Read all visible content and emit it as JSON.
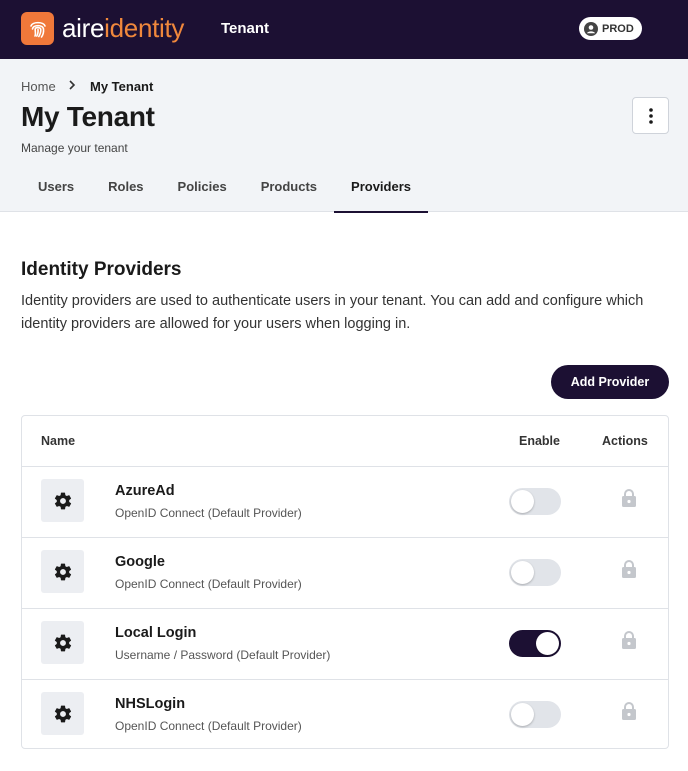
{
  "app": {
    "brand_part1": "aire",
    "brand_part2": "identity",
    "section_title": "Tenant",
    "environment": "PROD"
  },
  "breadcrumb": {
    "home": "Home",
    "current": "My Tenant"
  },
  "page": {
    "title": "My Tenant",
    "subtitle": "Manage your tenant"
  },
  "tabs": [
    {
      "label": "Users",
      "active": false
    },
    {
      "label": "Roles",
      "active": false
    },
    {
      "label": "Policies",
      "active": false
    },
    {
      "label": "Products",
      "active": false
    },
    {
      "label": "Providers",
      "active": true
    }
  ],
  "providers_section": {
    "title": "Identity Providers",
    "description": "Identity providers are used to authenticate users in your tenant. You can add and configure which identity providers are allowed for your users when logging in.",
    "add_button": "Add Provider"
  },
  "table": {
    "headers": {
      "name": "Name",
      "enable": "Enable",
      "actions": "Actions"
    },
    "rows": [
      {
        "name": "AzureAd",
        "type": "OpenID Connect (Default Provider)",
        "enabled": false,
        "icon": "gear-icon",
        "action_icon": "lock-icon"
      },
      {
        "name": "Google",
        "type": "OpenID Connect (Default Provider)",
        "enabled": false,
        "icon": "gear-icon",
        "action_icon": "lock-icon"
      },
      {
        "name": "Local Login",
        "type": "Username / Password (Default Provider)",
        "enabled": true,
        "icon": "gear-icon",
        "action_icon": "lock-icon"
      },
      {
        "name": "NHSLogin",
        "type": "OpenID Connect (Default Provider)",
        "enabled": false,
        "icon": "gear-icon",
        "action_icon": "lock-icon"
      }
    ]
  },
  "colors": {
    "brand_dark": "#1c1033",
    "brand_orange": "#f0783a",
    "header_bg": "#f2f4f7"
  }
}
